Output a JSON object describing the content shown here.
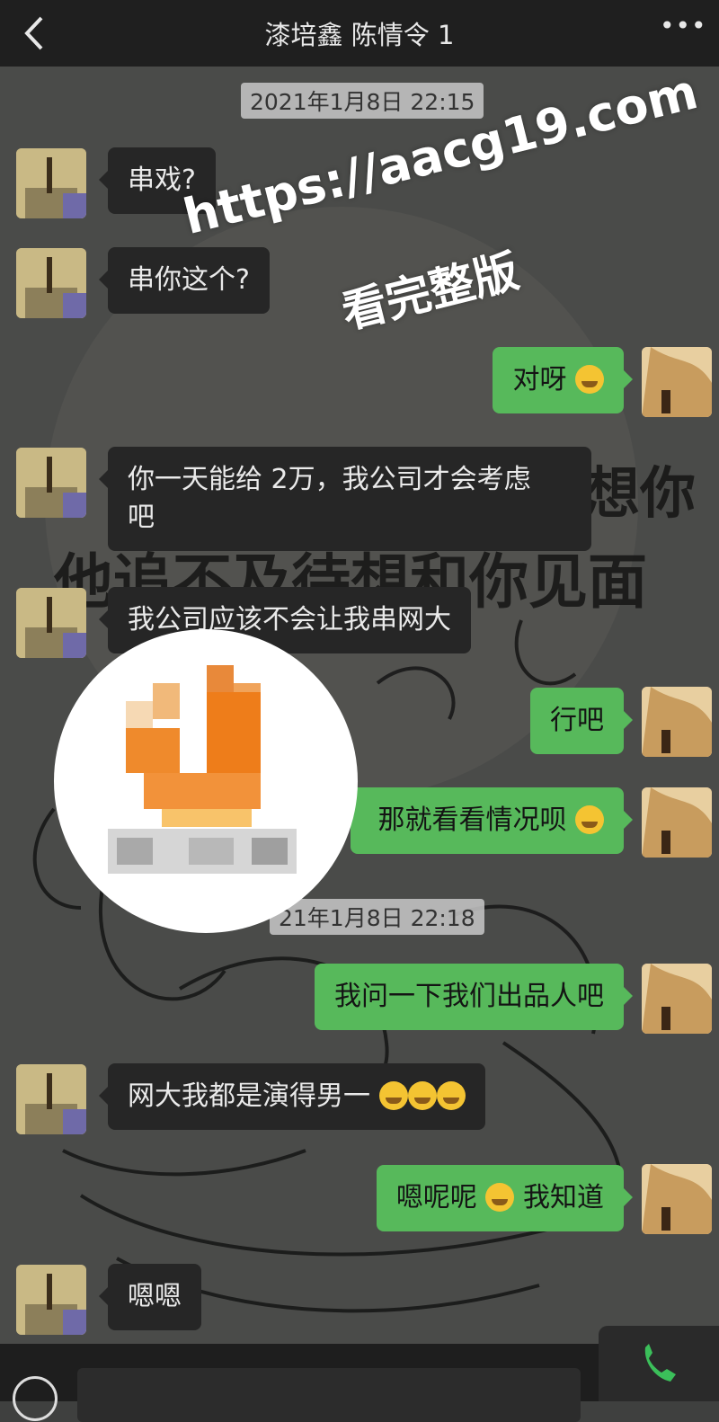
{
  "header": {
    "title": "漆培鑫 陈情令 1",
    "back_icon": "back-chevron-icon",
    "more_icon": "more-dots-icon"
  },
  "timestamps": [
    "2021年1月8日 22:15",
    "21年1月8日 22:18"
  ],
  "messages": [
    {
      "side": "left",
      "text": "串戏?"
    },
    {
      "side": "left",
      "text": "串你这个?"
    },
    {
      "side": "right",
      "text": "对呀"
    },
    {
      "side": "left",
      "text": "你一天能给 2万，我公司才会考虑",
      "text2": "吧"
    },
    {
      "side": "left",
      "text": "我公司应该不会让我串网大"
    },
    {
      "side": "right",
      "text": "行吧"
    },
    {
      "side": "right",
      "text": "那就看看情况呗"
    },
    {
      "side": "right",
      "text": "我问一下我们出品人吧"
    },
    {
      "side": "left",
      "text": "网大我都是演得男一"
    },
    {
      "side": "right",
      "text": "嗯呢呢",
      "text2": "我知道"
    },
    {
      "side": "left",
      "text": "嗯嗯"
    }
  ],
  "watermark": {
    "line1": "https://aacg19.com",
    "line2": "看完整版"
  },
  "background_text": [
    "想你",
    "他追不及待想和你见面"
  ],
  "icons": {
    "emoji": "crying-face-emoji",
    "call": "phone-icon",
    "voice": "voice-icon",
    "logo": "pixelated-logo"
  },
  "colors": {
    "right_bubble": "#57b95b",
    "left_bubble": "#262626",
    "topbar": "#1f1f1f"
  }
}
